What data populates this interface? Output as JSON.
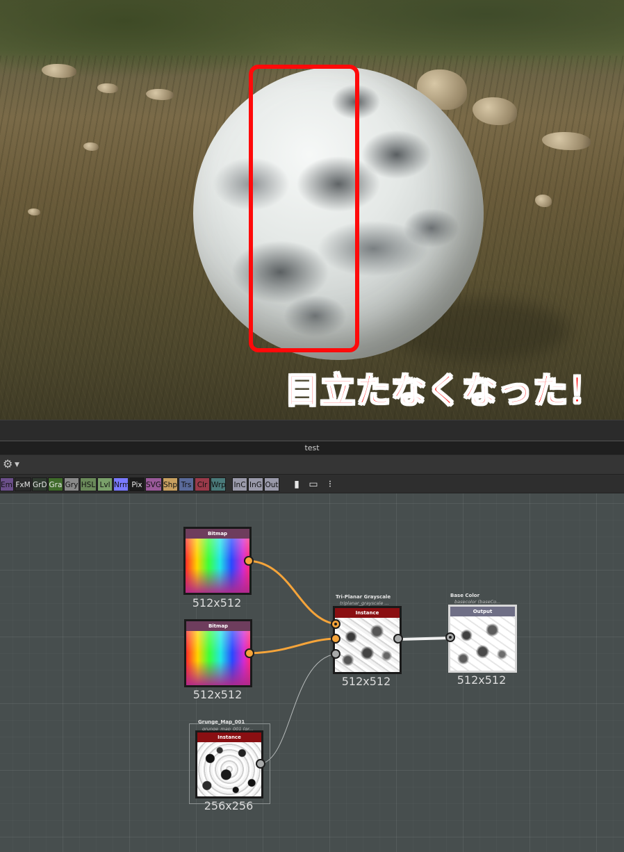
{
  "viewport": {
    "annotation_text": "目立たなくなった！",
    "highlight_color": "#ff0a0a"
  },
  "window": {
    "title": "test"
  },
  "toolbar": {
    "buttons": [
      {
        "label": "Emb",
        "color": "#6b4f8a"
      },
      {
        "label": "FxM",
        "color": "#2a2a2a"
      },
      {
        "label": "GrD",
        "color": "#2f3a2f"
      },
      {
        "label": "Gra",
        "color": "#3f6b2a"
      },
      {
        "label": "Gry",
        "color": "#8a8a8a"
      },
      {
        "label": "HSL",
        "color": "#6a8a5a"
      },
      {
        "label": "Lvl",
        "color": "#7aa06a"
      },
      {
        "label": "Nrm",
        "color": "#7a7aff"
      },
      {
        "label": "Pix",
        "color": "#1a1a1a"
      },
      {
        "label": "SVG",
        "color": "#9a5a9a"
      },
      {
        "label": "Shp",
        "color": "#c8a060"
      },
      {
        "label": "Trs",
        "color": "#5a6a9a"
      },
      {
        "label": "Clr",
        "color": "#9a3a4a"
      },
      {
        "label": "Wrp",
        "color": "#4a7a7a"
      },
      {
        "label": "InC",
        "color": "#9a9aaa"
      },
      {
        "label": "InG",
        "color": "#9a9aaa"
      },
      {
        "label": "Out",
        "color": "#9a9aaa"
      }
    ],
    "icons": [
      "comment-icon",
      "frame-icon",
      "pin-icon"
    ]
  },
  "graph": {
    "nodes": {
      "bitmap1": {
        "header": "Bitmap",
        "size": "512x512",
        "header_color": "#6e3d5d"
      },
      "bitmap2": {
        "header": "Bitmap",
        "size": "512x512",
        "header_color": "#6e3d5d"
      },
      "grunge": {
        "caption": "Grunge_Map_001",
        "subcaption": "grunge_map_001 (gr...",
        "header": "Instance",
        "size": "256x256",
        "header_color": "#8a0f12"
      },
      "triplanar": {
        "caption": "Tri-Planar Grayscale",
        "subcaption": "triplanar_grayscale ...",
        "header": "Instance",
        "size": "512x512",
        "header_color": "#8a0f12"
      },
      "output": {
        "caption": "Base Color",
        "subcaption": "basecolor (baseCo...",
        "header": "Output",
        "size": "512x512",
        "header_color": "#6f6f86"
      }
    },
    "wire_colors": {
      "color_wire": "#f5a43a",
      "gray_wire": "#b8bcbc",
      "output_wire": "#f2f2f2"
    }
  }
}
